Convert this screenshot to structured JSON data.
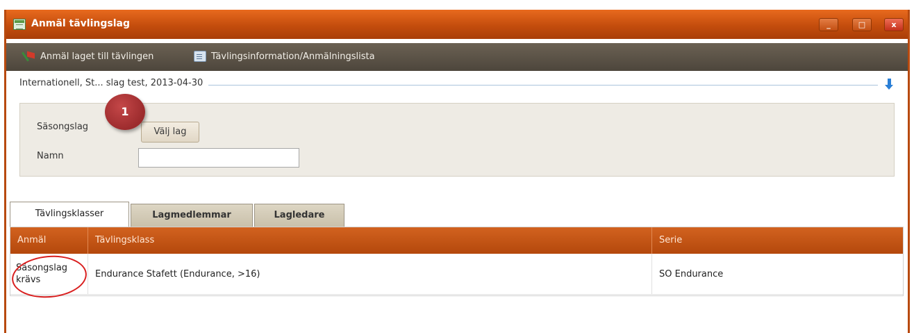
{
  "window": {
    "title": "Anmäl tävlingslag",
    "controls": {
      "minimize": "_",
      "maximize": "□",
      "close": "x"
    }
  },
  "toolbar": {
    "register_label": "Anmäl laget till tävlingen",
    "info_label": "Tävlingsinformation/Anmälningslista"
  },
  "section": {
    "competition_text": "Internationell, St... slag test, 2013-04-30"
  },
  "form": {
    "season_team_label": "Säsongslag",
    "choose_team_button": "Välj lag",
    "name_label": "Namn",
    "name_value": ""
  },
  "callout": {
    "number": "1"
  },
  "tabs": [
    {
      "label": "Tävlingsklasser",
      "active": true
    },
    {
      "label": "Lagmedlemmar",
      "active": false
    },
    {
      "label": "Lagledare",
      "active": false
    }
  ],
  "grid": {
    "columns": [
      "Anmäl",
      "Tävlingsklass",
      "Serie"
    ],
    "rows": [
      {
        "sign": [
          "Säsongslag",
          "krävs"
        ],
        "class": "Endurance Stafett (Endurance, >16)",
        "series": "SO Endurance"
      }
    ]
  },
  "colors": {
    "titlebar": "#c44d0d",
    "toolbar": "#5c5448",
    "grid_header": "#c4560f",
    "annotation_red": "#d91f1f"
  }
}
